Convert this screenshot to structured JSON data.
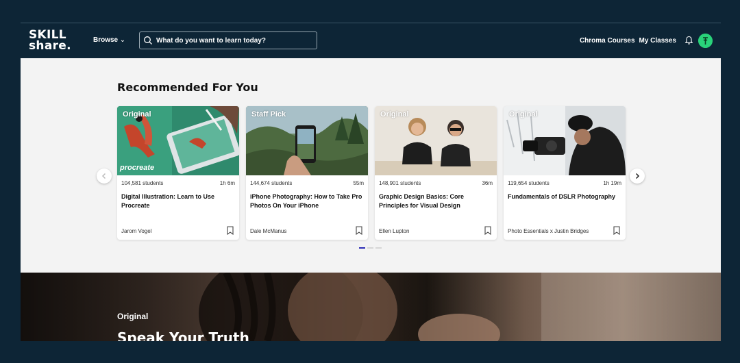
{
  "header": {
    "logo_line1": "SKILL",
    "logo_line2": "share.",
    "browse_label": "Browse",
    "search_placeholder": "What do you want to learn today?",
    "nav_links": [
      "Chroma Courses",
      "My Classes"
    ]
  },
  "recommended": {
    "title": "Recommended For You",
    "cards": [
      {
        "badge": "Original",
        "students": "104,581 students",
        "duration": "1h 6m",
        "title": "Digital Illustration: Learn to Use Procreate",
        "author": "Jarom Vogel",
        "thumb_text": "procreate"
      },
      {
        "badge": "Staff Pick",
        "students": "144,674 students",
        "duration": "55m",
        "title": "iPhone Photography: How to Take Pro Photos On Your iPhone",
        "author": "Dale McManus"
      },
      {
        "badge": "Original",
        "students": "148,901 students",
        "duration": "36m",
        "title": "Graphic Design Basics: Core Principles for Visual Design",
        "author": "Ellen Lupton"
      },
      {
        "badge": "Original",
        "students": "119,654 students",
        "duration": "1h 19m",
        "title": "Fundamentals of DSLR Photography",
        "author": "Photo Essentials x Justin Bridges"
      }
    ],
    "pagination": {
      "pages": 3,
      "active": 1
    }
  },
  "hero": {
    "label": "Original",
    "title": "Speak Your Truth"
  },
  "colors": {
    "background": "#0d2536",
    "avatar": "#29d27a",
    "pagination_active": "#2b2bb6"
  }
}
